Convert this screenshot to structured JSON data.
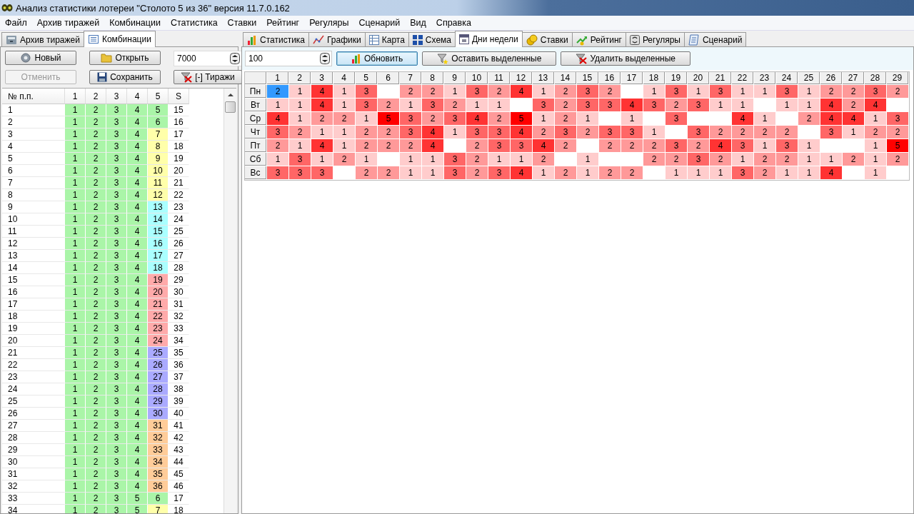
{
  "window": {
    "title": "Анализ статистики лотереи \"Столото 5 из 36\" версия 11.7.0.162"
  },
  "menu": [
    "Файл",
    "Архив тиражей",
    "Комбинации",
    "Статистика",
    "Ставки",
    "Рейтинг",
    "Регуляры",
    "Сценарий",
    "Вид",
    "Справка"
  ],
  "left_tabs": [
    {
      "label": "Архив тиражей",
      "selected": false
    },
    {
      "label": "Комбинации",
      "selected": true
    }
  ],
  "left_toolbar": {
    "buttons": [
      {
        "label": "Новый",
        "disabled": false
      },
      {
        "label": "Открыть",
        "disabled": false
      },
      {
        "label": "Отменить",
        "disabled": true
      },
      {
        "label": "Сохранить",
        "disabled": false
      },
      {
        "label": "[-] Тиражи",
        "disabled": false
      }
    ],
    "count": {
      "value": "7000"
    }
  },
  "combinations": {
    "columns": [
      "№ п.п.",
      "1",
      "2",
      "3",
      "4",
      "5",
      "S"
    ],
    "rows": [
      [
        "1",
        "1",
        "2",
        "3",
        "4",
        "5",
        "15"
      ],
      [
        "2",
        "1",
        "2",
        "3",
        "4",
        "6",
        "16"
      ],
      [
        "3",
        "1",
        "2",
        "3",
        "4",
        "7",
        "17"
      ],
      [
        "4",
        "1",
        "2",
        "3",
        "4",
        "8",
        "18"
      ],
      [
        "5",
        "1",
        "2",
        "3",
        "4",
        "9",
        "19"
      ],
      [
        "6",
        "1",
        "2",
        "3",
        "4",
        "10",
        "20"
      ],
      [
        "7",
        "1",
        "2",
        "3",
        "4",
        "11",
        "21"
      ],
      [
        "8",
        "1",
        "2",
        "3",
        "4",
        "12",
        "22"
      ],
      [
        "9",
        "1",
        "2",
        "3",
        "4",
        "13",
        "23"
      ],
      [
        "10",
        "1",
        "2",
        "3",
        "4",
        "14",
        "24"
      ],
      [
        "11",
        "1",
        "2",
        "3",
        "4",
        "15",
        "25"
      ],
      [
        "12",
        "1",
        "2",
        "3",
        "4",
        "16",
        "26"
      ],
      [
        "13",
        "1",
        "2",
        "3",
        "4",
        "17",
        "27"
      ],
      [
        "14",
        "1",
        "2",
        "3",
        "4",
        "18",
        "28"
      ],
      [
        "15",
        "1",
        "2",
        "3",
        "4",
        "19",
        "29"
      ],
      [
        "16",
        "1",
        "2",
        "3",
        "4",
        "20",
        "30"
      ],
      [
        "17",
        "1",
        "2",
        "3",
        "4",
        "21",
        "31"
      ],
      [
        "18",
        "1",
        "2",
        "3",
        "4",
        "22",
        "32"
      ],
      [
        "19",
        "1",
        "2",
        "3",
        "4",
        "23",
        "33"
      ],
      [
        "20",
        "1",
        "2",
        "3",
        "4",
        "24",
        "34"
      ],
      [
        "21",
        "1",
        "2",
        "3",
        "4",
        "25",
        "35"
      ],
      [
        "22",
        "1",
        "2",
        "3",
        "4",
        "26",
        "36"
      ],
      [
        "23",
        "1",
        "2",
        "3",
        "4",
        "27",
        "37"
      ],
      [
        "24",
        "1",
        "2",
        "3",
        "4",
        "28",
        "38"
      ],
      [
        "25",
        "1",
        "2",
        "3",
        "4",
        "29",
        "39"
      ],
      [
        "26",
        "1",
        "2",
        "3",
        "4",
        "30",
        "40"
      ],
      [
        "27",
        "1",
        "2",
        "3",
        "4",
        "31",
        "41"
      ],
      [
        "28",
        "1",
        "2",
        "3",
        "4",
        "32",
        "42"
      ],
      [
        "29",
        "1",
        "2",
        "3",
        "4",
        "33",
        "43"
      ],
      [
        "30",
        "1",
        "2",
        "3",
        "4",
        "34",
        "44"
      ],
      [
        "31",
        "1",
        "2",
        "3",
        "4",
        "35",
        "45"
      ],
      [
        "32",
        "1",
        "2",
        "3",
        "4",
        "36",
        "46"
      ],
      [
        "33",
        "1",
        "2",
        "3",
        "5",
        "6",
        "17"
      ],
      [
        "34",
        "1",
        "2",
        "3",
        "5",
        "7",
        "18"
      ]
    ]
  },
  "right_tabs": [
    {
      "label": "Статистика",
      "selected": false
    },
    {
      "label": "Графики",
      "selected": false
    },
    {
      "label": "Карта",
      "selected": false
    },
    {
      "label": "Схема",
      "selected": false
    },
    {
      "label": "Дни недели",
      "selected": true
    },
    {
      "label": "Ставки",
      "selected": false
    },
    {
      "label": "Рейтинг",
      "selected": false
    },
    {
      "label": "Регуляры",
      "selected": false
    },
    {
      "label": "Сценарий",
      "selected": false
    }
  ],
  "right_toolbar": {
    "depth": {
      "value": "100"
    },
    "buttons": [
      {
        "label": "Обновить",
        "focused": true
      },
      {
        "label": "Оставить выделенные",
        "focused": false
      },
      {
        "label": "Удалить выделенные",
        "focused": false
      }
    ]
  },
  "weekday_grid": {
    "columns": [
      "1",
      "2",
      "3",
      "4",
      "5",
      "6",
      "7",
      "8",
      "9",
      "10",
      "11",
      "12",
      "13",
      "14",
      "15",
      "16",
      "17",
      "18",
      "19",
      "20",
      "21",
      "22",
      "23",
      "24",
      "25",
      "26",
      "27",
      "28",
      "29"
    ],
    "rows": [
      {
        "day": "Пн",
        "cells": [
          {
            "v": "2",
            "selected": true
          },
          {
            "v": "1",
            "selected": false
          },
          {
            "v": "4",
            "selected": false
          },
          {
            "v": "1",
            "selected": false
          },
          {
            "v": "3",
            "selected": false
          },
          {
            "selected": false
          },
          {
            "v": "2",
            "selected": false
          },
          {
            "v": "2",
            "selected": false
          },
          {
            "v": "1",
            "selected": false
          },
          {
            "v": "3",
            "selected": false
          },
          {
            "v": "2",
            "selected": false
          },
          {
            "v": "4",
            "selected": false
          },
          {
            "v": "1",
            "selected": false
          },
          {
            "v": "2",
            "selected": false
          },
          {
            "v": "3",
            "selected": false
          },
          {
            "v": "2",
            "selected": false
          },
          {
            "selected": false
          },
          {
            "v": "1",
            "selected": false
          },
          {
            "v": "3",
            "selected": false
          },
          {
            "v": "1",
            "selected": false
          },
          {
            "v": "3",
            "selected": false
          },
          {
            "v": "1",
            "selected": false
          },
          {
            "v": "1",
            "selected": false
          },
          {
            "v": "3",
            "selected": false
          },
          {
            "v": "1",
            "selected": false
          },
          {
            "v": "2",
            "selected": false
          },
          {
            "v": "2",
            "selected": false
          },
          {
            "v": "3",
            "selected": false
          },
          {
            "v": "2",
            "selected": false
          }
        ]
      },
      {
        "day": "Вт",
        "cells": [
          {
            "v": "1",
            "selected": false
          },
          {
            "v": "1",
            "selected": false
          },
          {
            "v": "4",
            "selected": false
          },
          {
            "v": "1",
            "selected": false
          },
          {
            "v": "3",
            "selected": false
          },
          {
            "v": "2",
            "selected": false
          },
          {
            "v": "1",
            "selected": false
          },
          {
            "v": "3",
            "selected": false
          },
          {
            "v": "2",
            "selected": false
          },
          {
            "v": "1",
            "selected": false
          },
          {
            "v": "1",
            "selected": false
          },
          {
            "selected": false
          },
          {
            "v": "3",
            "selected": false
          },
          {
            "v": "2",
            "selected": false
          },
          {
            "v": "3",
            "selected": false
          },
          {
            "v": "3",
            "selected": false
          },
          {
            "v": "4",
            "selected": false
          },
          {
            "v": "3",
            "selected": false
          },
          {
            "v": "2",
            "selected": false
          },
          {
            "v": "3",
            "selected": false
          },
          {
            "v": "1",
            "selected": false
          },
          {
            "v": "1",
            "selected": false
          },
          {
            "selected": false
          },
          {
            "v": "1",
            "selected": false
          },
          {
            "v": "1",
            "selected": false
          },
          {
            "v": "4",
            "selected": false
          },
          {
            "v": "2",
            "selected": false
          },
          {
            "v": "4",
            "selected": false
          },
          {
            "selected": false
          }
        ]
      },
      {
        "day": "Ср",
        "cells": [
          {
            "v": "4",
            "selected": false
          },
          {
            "v": "1",
            "selected": false
          },
          {
            "v": "2",
            "selected": false
          },
          {
            "v": "2",
            "selected": false
          },
          {
            "v": "1",
            "selected": false
          },
          {
            "v": "5",
            "selected": false
          },
          {
            "v": "3",
            "selected": false
          },
          {
            "v": "2",
            "selected": false
          },
          {
            "v": "3",
            "selected": false
          },
          {
            "v": "4",
            "selected": false
          },
          {
            "v": "2",
            "selected": false
          },
          {
            "v": "5",
            "selected": false
          },
          {
            "v": "1",
            "selected": false
          },
          {
            "v": "2",
            "selected": false
          },
          {
            "v": "1",
            "selected": false
          },
          {
            "selected": false
          },
          {
            "v": "1",
            "selected": false
          },
          {
            "selected": false
          },
          {
            "v": "3",
            "selected": false
          },
          {
            "selected": false
          },
          {
            "selected": false
          },
          {
            "v": "4",
            "selected": false
          },
          {
            "v": "1",
            "selected": false
          },
          {
            "selected": false
          },
          {
            "v": "2",
            "selected": false
          },
          {
            "v": "4",
            "selected": false
          },
          {
            "v": "4",
            "selected": false
          },
          {
            "v": "1",
            "selected": false
          },
          {
            "v": "3",
            "selected": false
          }
        ]
      },
      {
        "day": "Чт",
        "cells": [
          {
            "v": "3",
            "selected": false
          },
          {
            "v": "2",
            "selected": false
          },
          {
            "v": "1",
            "selected": false
          },
          {
            "v": "1",
            "selected": false
          },
          {
            "v": "2",
            "selected": false
          },
          {
            "v": "2",
            "selected": false
          },
          {
            "v": "3",
            "selected": false
          },
          {
            "v": "4",
            "selected": false
          },
          {
            "v": "1",
            "selected": false
          },
          {
            "v": "3",
            "selected": false
          },
          {
            "v": "3",
            "selected": false
          },
          {
            "v": "4",
            "selected": false
          },
          {
            "v": "2",
            "selected": false
          },
          {
            "v": "3",
            "selected": false
          },
          {
            "v": "2",
            "selected": false
          },
          {
            "v": "3",
            "selected": false
          },
          {
            "v": "3",
            "selected": false
          },
          {
            "v": "1",
            "selected": false
          },
          {
            "selected": false
          },
          {
            "v": "3",
            "selected": false
          },
          {
            "v": "2",
            "selected": false
          },
          {
            "v": "2",
            "selected": false
          },
          {
            "v": "2",
            "selected": false
          },
          {
            "v": "2",
            "selected": false
          },
          {
            "selected": false
          },
          {
            "v": "3",
            "selected": false
          },
          {
            "v": "1",
            "selected": false
          },
          {
            "v": "2",
            "selected": false
          },
          {
            "v": "2",
            "selected": false
          }
        ]
      },
      {
        "day": "Пт",
        "cells": [
          {
            "v": "2",
            "selected": false
          },
          {
            "v": "1",
            "selected": false
          },
          {
            "v": "4",
            "selected": false
          },
          {
            "v": "1",
            "selected": false
          },
          {
            "v": "2",
            "selected": false
          },
          {
            "v": "2",
            "selected": false
          },
          {
            "v": "2",
            "selected": false
          },
          {
            "v": "4",
            "selected": false
          },
          {
            "selected": false
          },
          {
            "v": "2",
            "selected": false
          },
          {
            "v": "3",
            "selected": false
          },
          {
            "v": "3",
            "selected": false
          },
          {
            "v": "4",
            "selected": false
          },
          {
            "v": "2",
            "selected": false
          },
          {
            "selected": false
          },
          {
            "v": "2",
            "selected": false
          },
          {
            "v": "2",
            "selected": false
          },
          {
            "v": "2",
            "selected": false
          },
          {
            "v": "3",
            "selected": false
          },
          {
            "v": "2",
            "selected": false
          },
          {
            "v": "4",
            "selected": false
          },
          {
            "v": "3",
            "selected": false
          },
          {
            "v": "1",
            "selected": false
          },
          {
            "v": "3",
            "selected": false
          },
          {
            "v": "1",
            "selected": false
          },
          {
            "selected": false
          },
          {
            "selected": false
          },
          {
            "v": "1",
            "selected": false
          },
          {
            "v": "5",
            "selected": false
          }
        ]
      },
      {
        "day": "Сб",
        "cells": [
          {
            "v": "1",
            "selected": false
          },
          {
            "v": "3",
            "selected": false
          },
          {
            "v": "1",
            "selected": false
          },
          {
            "v": "2",
            "selected": false
          },
          {
            "v": "1",
            "selected": false
          },
          {
            "selected": false
          },
          {
            "v": "1",
            "selected": false
          },
          {
            "v": "1",
            "selected": false
          },
          {
            "v": "3",
            "selected": false
          },
          {
            "v": "2",
            "selected": false
          },
          {
            "v": "1",
            "selected": false
          },
          {
            "v": "1",
            "selected": false
          },
          {
            "v": "2",
            "selected": false
          },
          {
            "selected": false
          },
          {
            "v": "1",
            "selected": false
          },
          {
            "selected": false
          },
          {
            "selected": false
          },
          {
            "v": "2",
            "selected": false
          },
          {
            "v": "2",
            "selected": false
          },
          {
            "v": "3",
            "selected": false
          },
          {
            "v": "2",
            "selected": false
          },
          {
            "v": "1",
            "selected": false
          },
          {
            "v": "2",
            "selected": false
          },
          {
            "v": "2",
            "selected": false
          },
          {
            "v": "1",
            "selected": false
          },
          {
            "v": "1",
            "selected": false
          },
          {
            "v": "2",
            "selected": false
          },
          {
            "v": "1",
            "selected": false
          },
          {
            "v": "2",
            "selected": false
          }
        ]
      },
      {
        "day": "Вс",
        "cells": [
          {
            "v": "3",
            "selected": false
          },
          {
            "v": "3",
            "selected": false
          },
          {
            "v": "3",
            "selected": false
          },
          {
            "selected": false
          },
          {
            "v": "2",
            "selected": false
          },
          {
            "v": "2",
            "selected": false
          },
          {
            "v": "1",
            "selected": false
          },
          {
            "v": "1",
            "selected": false
          },
          {
            "v": "3",
            "selected": false
          },
          {
            "v": "2",
            "selected": false
          },
          {
            "v": "3",
            "selected": false
          },
          {
            "v": "4",
            "selected": false
          },
          {
            "v": "1",
            "selected": false
          },
          {
            "v": "2",
            "selected": false
          },
          {
            "v": "1",
            "selected": false
          },
          {
            "v": "2",
            "selected": false
          },
          {
            "v": "2",
            "selected": false
          },
          {
            "selected": false
          },
          {
            "v": "1",
            "selected": false
          },
          {
            "v": "1",
            "selected": false
          },
          {
            "v": "1",
            "selected": false
          },
          {
            "v": "3",
            "selected": false
          },
          {
            "v": "2",
            "selected": false
          },
          {
            "v": "1",
            "selected": false
          },
          {
            "v": "1",
            "selected": false
          },
          {
            "v": "4",
            "selected": false
          },
          {
            "selected": false
          },
          {
            "v": "1",
            "selected": false
          },
          {
            "selected": false
          }
        ]
      }
    ]
  }
}
